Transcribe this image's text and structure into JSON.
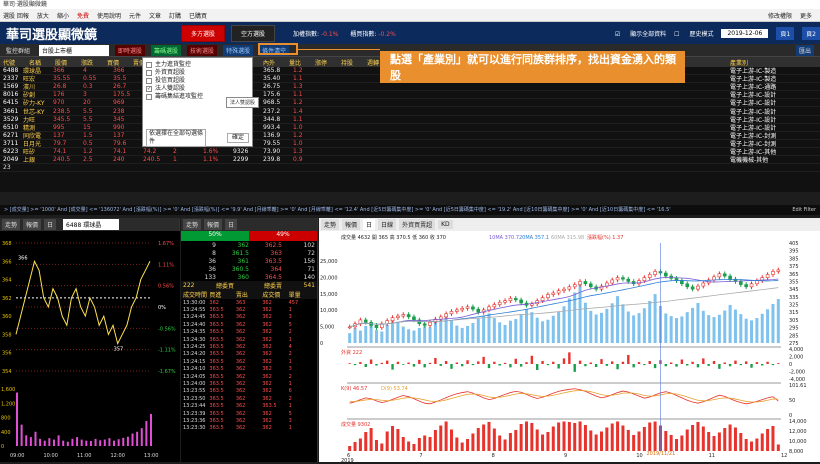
{
  "app": {
    "window_title": "華司·選股顯微鏡"
  },
  "menu": {
    "items": [
      "選股 回報",
      "放大",
      "縮小",
      "免費",
      "使用說明",
      "元件",
      "文章",
      "訂購",
      "已購買"
    ],
    "right": [
      "修改權限",
      "更多"
    ]
  },
  "header": {
    "logo": "華司選股顯微鏡",
    "btn_long": "多方選股",
    "btn_short": "空方選股",
    "stat1_label": "加權指數:",
    "stat1_value": "-0.1%",
    "stat2_label": "櫃買指數:",
    "stat2_value": "-0.2%",
    "chk1": "顯示全部資料",
    "chk2": "歷史模式",
    "date": "2019-12-06",
    "page1": "頁1",
    "page2": "頁2"
  },
  "toolbar": {
    "watch": "監控群組",
    "market": "台股上市櫃",
    "t1": "即時選股",
    "t2": "籌碼選股",
    "t3": "技術選股",
    "t4": "特殊選股",
    "t5": "條件清空",
    "right": "匯出"
  },
  "table": {
    "headers": [
      "代號",
      "名稱",
      "股價",
      "漲跌",
      "買價",
      "賣價",
      "成交量",
      "漲幅",
      "總量",
      "均價",
      "內外",
      "量比",
      "漲停",
      "持股",
      "週轉",
      "外資",
      "投信",
      "自營",
      "分點",
      "主力",
      "產業別"
    ],
    "rows": [
      {
        "code": "6488",
        "name": "環球晶",
        "v": [
          "366",
          "4",
          "366",
          "367",
          "1",
          "1.1%",
          "6548",
          "365.8",
          "1.2"
        ],
        "ind": "電子上游-IC-製造"
      },
      {
        "code": "2337",
        "name": "旺宏",
        "v": [
          "35.55",
          "0.55",
          "35.5",
          "35.55",
          "8",
          "1.6%",
          "61526",
          "35.40",
          "1.1"
        ],
        "ind": "電子上游-IC-製造"
      },
      {
        "code": "1569",
        "name": "濱川",
        "v": [
          "26.8",
          "0.3",
          "26.7",
          "26.8",
          "2",
          "1.1%",
          "1884",
          "26.75",
          "1.3"
        ],
        "ind": "電子上游-IC-通路"
      },
      {
        "code": "8016",
        "name": "矽創",
        "v": [
          "176",
          "3",
          "175.5",
          "176",
          "3",
          "1.7%",
          "1742",
          "175.6",
          "1.1"
        ],
        "ind": "電子上游-IC-設計"
      },
      {
        "code": "6415",
        "name": "矽力-KY",
        "v": [
          "970",
          "20",
          "969",
          "970",
          "1",
          "2.1%",
          "1032",
          "968.5",
          "1.2"
        ],
        "ind": "電子上游-IC-設計"
      },
      {
        "code": "3661",
        "name": "世芯-KY",
        "v": [
          "238.5",
          "5.5",
          "238",
          "238.5",
          "6",
          "2.4%",
          "19638",
          "237.2",
          "1.4"
        ],
        "ind": "電子上游-IC-設計"
      },
      {
        "code": "3529",
        "name": "力旺",
        "v": [
          "345.5",
          "5.5",
          "345",
          "345.5",
          "2",
          "1.6%",
          "1028",
          "344.8",
          "1.1"
        ],
        "ind": "電子上游-IC-設計"
      },
      {
        "code": "6510",
        "name": "精測",
        "v": [
          "995",
          "15",
          "990",
          "995",
          "1",
          "1.5%",
          "2729",
          "993.4",
          "1.0"
        ],
        "ind": "電子上游-IC-設計"
      },
      {
        "code": "6271",
        "name": "同欣電",
        "v": [
          "137",
          "1.5",
          "137",
          "137.5",
          "2",
          "1.1%",
          "3252",
          "136.9",
          "1.2"
        ],
        "ind": "電子上游-IC-封測"
      },
      {
        "code": "3711",
        "name": "日月光",
        "v": [
          "79.7",
          "0.5",
          "79.6",
          "79.7",
          "9",
          "0.6%",
          "33637",
          "79.55",
          "1.0"
        ],
        "ind": "電子上游-IC-封測"
      },
      {
        "code": "6223",
        "name": "旺矽",
        "v": [
          "74.1",
          "1.2",
          "74.1",
          "74.2",
          "2",
          "1.6%",
          "9326",
          "73.90",
          "1.3"
        ],
        "ind": "電子上游-IC-其他"
      },
      {
        "code": "2049",
        "name": "上銀",
        "v": [
          "240.5",
          "2.5",
          "240",
          "240.5",
          "1",
          "1.1%",
          "2299",
          "239.8",
          "0.9"
        ],
        "ind": "電機機械-其他"
      }
    ],
    "count": "23"
  },
  "dropdown": {
    "items": [
      {
        "label": "主力進貨監控",
        "checked": false
      },
      {
        "label": "外資買超股",
        "checked": false
      },
      {
        "label": "投信買超股",
        "checked": false
      },
      {
        "label": "法人雙認股",
        "checked": true
      },
      {
        "label": "籌碼集結進攻監控",
        "checked": false
      }
    ],
    "select": "依選擇在全部勾選條件",
    "ok": "確定"
  },
  "tooltip": "法人雙認股",
  "callout": {
    "text": "點選「產業別」就可以進行同族群排序，找出資金湧入的類股"
  },
  "filter": {
    "text": "> [成交量] >= '1000' And [成交量] <= '136072' And [漲跌幅(%)] >= '0' And [漲跌幅(%)] <= '9.9' And [月線乖離] >= '0' And [月線乖離] <= '12.4' And [近5日籌碼集中度] >= '0' And [近5日籌碼集中度] <= '19.2' And [近10日籌碼集中度] >= '0' And [近10日籌碼集中度] <= '16.5'",
    "edit": "Edit Filter"
  },
  "intraday": {
    "tabs": [
      "走勢",
      "報價",
      "日"
    ],
    "symbol": "6488 環球晶",
    "prices": [
      "368",
      "366",
      "364",
      "362",
      "360",
      "358",
      "356",
      "354"
    ],
    "pcts": [
      "1.67%",
      "1.11%",
      "0.56%",
      "0%",
      "-0.56%",
      "-1.11%",
      "-1.67%"
    ],
    "vols": [
      "1,600",
      "1,200",
      "800",
      "400",
      "0"
    ],
    "times": [
      "09:00",
      "10:00",
      "11:00",
      "12:00",
      "13:00"
    ],
    "high": "366",
    "low": "357",
    "ref": "362",
    "price_line": [
      358,
      360,
      362,
      364,
      366,
      365,
      362,
      361,
      363,
      362,
      360,
      359,
      362,
      363,
      361,
      360,
      362,
      361,
      359,
      360,
      358,
      359,
      357,
      358,
      359,
      361,
      362,
      364,
      365,
      366
    ],
    "vol_bars": [
      1500,
      600,
      300,
      250,
      400,
      200,
      150,
      220,
      180,
      300,
      150,
      120,
      200,
      250,
      180,
      150,
      140,
      200,
      160,
      180,
      220,
      150,
      190,
      230,
      260,
      350,
      400,
      500,
      700,
      900
    ]
  },
  "depth": {
    "tabs": [
      "走勢",
      "報價",
      "日"
    ],
    "buy_pct": "50%",
    "sell_pct": "49%",
    "bid_rows": [
      [
        "9",
        "362",
        "362.5",
        "102"
      ],
      [
        "8",
        "361.5",
        "363",
        "72"
      ],
      [
        "36",
        "361",
        "363.5",
        "156"
      ],
      [
        "36",
        "360.5",
        "364",
        "71"
      ],
      [
        "133",
        "360",
        "364.5",
        "140"
      ]
    ],
    "sum_label": "222",
    "sum_mid": "總委買",
    "sum_right": "總委賣",
    "sum_right_val": "541",
    "tick_headers": [
      "成交時間",
      "買進",
      "賣出",
      "成交價",
      "單量"
    ],
    "ticks": [
      [
        "13:30:00",
        "362",
        "363",
        "362",
        "457"
      ],
      [
        "13:24:55",
        "363.5",
        "362",
        "362",
        "1"
      ],
      [
        "13:24:45",
        "363.5",
        "362",
        "362",
        "3"
      ],
      [
        "13:24:40",
        "363.5",
        "362",
        "362",
        "5"
      ],
      [
        "13:24:35",
        "363.5",
        "362",
        "362",
        "2"
      ],
      [
        "13:24:30",
        "363.5",
        "362",
        "362",
        "1"
      ],
      [
        "13:24:25",
        "363.5",
        "362",
        "362",
        "4"
      ],
      [
        "13:24:20",
        "363.5",
        "362",
        "362",
        "2"
      ],
      [
        "13:24:15",
        "363.5",
        "362",
        "362",
        "1"
      ],
      [
        "13:24:10",
        "363.5",
        "362",
        "362",
        "3"
      ],
      [
        "13:24:05",
        "363.5",
        "362",
        "362",
        "2"
      ],
      [
        "13:24:00",
        "363.5",
        "362",
        "362",
        "1"
      ],
      [
        "13:23:55",
        "363.5",
        "362",
        "362",
        "6"
      ],
      [
        "13:23:50",
        "363.5",
        "362",
        "362",
        "2"
      ],
      [
        "13:23:44",
        "363.5",
        "362",
        "363.5",
        "1"
      ],
      [
        "13:23:39",
        "363.5",
        "362",
        "362",
        "5"
      ],
      [
        "13:23:36",
        "363.5",
        "362",
        "362",
        "3"
      ],
      [
        "13:23:30",
        "363.5",
        "362",
        "362",
        "1"
      ]
    ]
  },
  "kline": {
    "tabs": [
      "走勢",
      "報價",
      "日"
    ],
    "period": "日線",
    "indicator": "外資買賣超",
    "mode": "KD",
    "info": "成交量 4632  開 365  高 370.5  低 360  收 370",
    "ma10": "10MA 370.7",
    "ma20": "20MA 357.1",
    "ma60": "60MA 315.98",
    "chg": "漲跌幅(%) 1.37",
    "price_axis": [
      "405",
      "395",
      "385",
      "375",
      "365",
      "355",
      "345",
      "335",
      "325",
      "315",
      "305",
      "295",
      "285",
      "275"
    ],
    "vol_axis": [
      "25,000",
      "20,000",
      "15,000",
      "10,000",
      "5,000",
      "0"
    ],
    "foreign_label": "外資 222",
    "foreign_axis": [
      "4,000",
      "2,000",
      "0",
      "-2,000",
      "-4,000"
    ],
    "kd_label": "K(9) 46.57",
    "d_label": "D(9) 53.74",
    "kd_axis": [
      "101.61",
      "50",
      "0"
    ],
    "vol2_label": "成交量 9302",
    "vol2_axis": [
      "14,000",
      "12,000",
      "10,000",
      "8,000"
    ],
    "dates": [
      "6",
      "7",
      "8",
      "9",
      "10",
      "11",
      "12"
    ],
    "year": "2019",
    "cursor_date": "2019/11/21",
    "closes": [
      296,
      300,
      305,
      302,
      298,
      295,
      300,
      304,
      308,
      310,
      312,
      309,
      305,
      300,
      298,
      302,
      306,
      309,
      313,
      316,
      318,
      320,
      322,
      319,
      315,
      318,
      322,
      325,
      328,
      330,
      333,
      331,
      327,
      324,
      326,
      330,
      334,
      338,
      340,
      343,
      345,
      348,
      351,
      355,
      352,
      348,
      345,
      349,
      353,
      357,
      360,
      358,
      355,
      352,
      356,
      360,
      364,
      368,
      366,
      362,
      359,
      356,
      352,
      348,
      345,
      349,
      353,
      357,
      361,
      365,
      362,
      358,
      355,
      351,
      348,
      352,
      356,
      360,
      364,
      368,
      370
    ],
    "volumes": [
      3000,
      4500,
      3800,
      5200,
      6000,
      4000,
      3500,
      5500,
      7000,
      6500,
      5000,
      4200,
      3800,
      4600,
      5100,
      4800,
      6200,
      7200,
      8500,
      6900,
      5300,
      4600,
      5200,
      6100,
      7400,
      8200,
      9000,
      7600,
      6300,
      5500,
      6800,
      7300,
      8800,
      10200,
      9400,
      7700,
      6600,
      7100,
      8300,
      9600,
      11200,
      13600,
      15400,
      18200,
      12300,
      9800,
      8700,
      9200,
      10400,
      12100,
      14300,
      11800,
      9600,
      8400,
      9100,
      10600,
      12800,
      14900,
      11300,
      9000,
      8200,
      7600,
      8100,
      9400,
      10700,
      12200,
      9800,
      8500,
      7900,
      8600,
      9900,
      11600,
      10200,
      8800,
      7400,
      6900,
      7600,
      8900,
      10300,
      11900,
      13400
    ],
    "foreign": [
      200,
      -300,
      500,
      -800,
      1200,
      -400,
      300,
      900,
      -1500,
      600,
      -200,
      400,
      -700,
      1100,
      -900,
      300,
      1600,
      -500,
      800,
      -1300,
      400,
      -600,
      1000,
      -300,
      700,
      1900,
      -1100,
      600,
      -400,
      300,
      -900,
      1400,
      -700,
      500,
      2200,
      -1600,
      800,
      -300,
      600,
      -1200,
      1500,
      3100,
      -2100,
      900,
      -600,
      400,
      -800,
      1300,
      -500,
      700,
      -1400,
      600,
      2400,
      -900,
      500,
      -300,
      800,
      -1100,
      1000,
      -600,
      400,
      -700,
      1200,
      -400,
      600,
      -900,
      1500,
      -500,
      800,
      -1300,
      400,
      -600,
      900,
      -300,
      700,
      -1000,
      500,
      -400,
      600,
      -300,
      222
    ],
    "k_line": [
      40,
      45,
      52,
      58,
      55,
      48,
      42,
      46,
      53,
      60,
      66,
      62,
      55,
      47,
      40,
      38,
      44,
      51,
      59,
      66,
      72,
      76,
      79,
      74,
      66,
      58,
      52,
      56,
      63,
      70,
      76,
      80,
      77,
      70,
      62,
      56,
      60,
      67,
      74,
      80,
      84,
      87,
      89,
      86,
      80,
      72,
      64,
      58,
      62,
      69,
      76,
      81,
      78,
      71,
      64,
      57,
      61,
      68,
      75,
      79,
      74,
      66,
      58,
      50,
      44,
      40,
      45,
      52,
      60,
      67,
      63,
      55,
      48,
      42,
      38,
      41,
      46,
      52,
      58,
      62,
      47
    ],
    "d_line": [
      45,
      46,
      48,
      51,
      53,
      52,
      50,
      48,
      50,
      53,
      57,
      59,
      58,
      55,
      51,
      47,
      46,
      47,
      51,
      56,
      61,
      66,
      70,
      71,
      70,
      66,
      61,
      59,
      60,
      63,
      67,
      71,
      73,
      72,
      69,
      65,
      63,
      64,
      67,
      71,
      75,
      79,
      82,
      83,
      82,
      79,
      74,
      69,
      66,
      67,
      70,
      74,
      75,
      74,
      71,
      66,
      64,
      65,
      68,
      72,
      73,
      71,
      67,
      61,
      55,
      50,
      48,
      49,
      52,
      56,
      58,
      57,
      54,
      50,
      46,
      44,
      44,
      46,
      50,
      54,
      54
    ],
    "vol2_bars": [
      9000,
      9800,
      10500,
      11800,
      12600,
      10200,
      9500,
      11900,
      13000,
      12400,
      10800,
      9900,
      9400,
      10600,
      11100,
      10800,
      12200,
      13100,
      13900,
      12300,
      10700,
      9700,
      10400,
      11500,
      12600,
      13300,
      13800,
      12500,
      11100,
      10300,
      11600,
      12200,
      13400,
      13900,
      13600,
      12300,
      11300,
      11800,
      12900,
      13700,
      13900,
      13800,
      13600,
      13900,
      13200,
      12100,
      11300,
      11900,
      12700,
      13500,
      13900,
      13100,
      12200,
      11200,
      11900,
      12800,
      13700,
      13900,
      13100,
      12000,
      11200,
      10400,
      11100,
      12300,
      13200,
      13800,
      12900,
      11800,
      11000,
      11700,
      12600,
      13300,
      12700,
      11600,
      10400,
      9900,
      10500,
      11500,
      12400,
      13000,
      9302
    ],
    "colors": {
      "up": "#e8322c",
      "down": "#1a9e4b",
      "ma10": "#7a5cd6",
      "ma20": "#2f7fd6",
      "ma60": "#aaaaaa",
      "vol": "#7fc2ee",
      "k": "#e8322c",
      "d": "#e8a02c"
    }
  }
}
